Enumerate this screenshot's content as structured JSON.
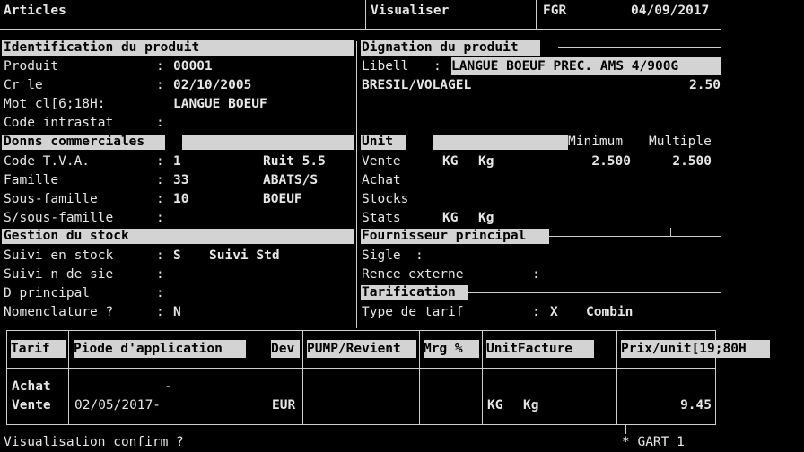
{
  "topbar": {
    "screen": "Articles",
    "mode": "Visualiser",
    "company": "FGR",
    "date": "04/09/2017"
  },
  "ident": {
    "title": "Identification du produit",
    "fields": [
      {
        "label": "Produit",
        "sep": ":",
        "value": "00001"
      },
      {
        "label": "Cr le",
        "sep": ":",
        "value": "02/10/2005"
      },
      {
        "label": "Mot cl[6;18H:",
        "value": "LANGUE BOEUF"
      },
      {
        "label": "Code intrastat",
        "sep": ":"
      }
    ]
  },
  "design": {
    "title": "Dignation du produit",
    "label": "Libell",
    "sep": ":",
    "value": "LANGUE BOEUF PREC. AMS 4/900G",
    "origin": "BRESIL/VOLAGEL",
    "number": "2.50"
  },
  "comm": {
    "title": "Donns commerciales",
    "fields": [
      {
        "label": "Code T.V.A.",
        "sep": ":",
        "value": "1",
        "extra": "Ruit 5.5"
      },
      {
        "label": "Famille",
        "sep": ":",
        "value": "33",
        "extra": "ABATS/S"
      },
      {
        "label": "Sous-famille",
        "sep": ":",
        "value": "10",
        "extra": "BOEUF"
      },
      {
        "label": "S/sous-famille",
        "sep": ":"
      }
    ]
  },
  "unit": {
    "title": "Unit",
    "col_min": "Minimum",
    "col_mult": "Multiple",
    "rows": [
      {
        "label": "Vente",
        "u1": "KG",
        "u2": "Kg",
        "min": "2.500",
        "mult": "2.500"
      },
      {
        "label": "Achat"
      },
      {
        "label": "Stocks"
      },
      {
        "label": "Stats",
        "u1": "KG",
        "u2": "Kg"
      }
    ]
  },
  "stock": {
    "title": "Gestion du stock",
    "fields": [
      {
        "label": "Suivi en stock",
        "sep": ":",
        "value": "S",
        "extra": "Suivi Std"
      },
      {
        "label": "Suivi n de sie",
        "sep": ":"
      },
      {
        "label": "D principal",
        "sep": ":"
      },
      {
        "label": "Nomenclature ?",
        "sep": ":",
        "value": "N"
      }
    ]
  },
  "fournisseur": {
    "title": "Fournisseur principal",
    "sigle_label": "Sigle",
    "sigle_sep": ":",
    "ref_label": "Rence externe",
    "ref_sep": ":"
  },
  "tarification": {
    "title": "Tarification",
    "type_label": "Type de tarif",
    "type_sep": ":",
    "type_value": "X",
    "type_extra": "Combin"
  },
  "price_table": {
    "headers": [
      "Tarif",
      "Piode d'application",
      "Dev",
      "PUMP/Revient",
      "Mrg %",
      "UnitFacture",
      "Prix/unit[19;80H"
    ],
    "rows": [
      {
        "tarif": "Achat",
        "periode": "-",
        "dev": "",
        "pump": "",
        "mrg": "",
        "u1": "",
        "u2": "",
        "prix": ""
      },
      {
        "tarif": "Vente",
        "periode": "02/05/2017-",
        "dev": "EUR",
        "pump": "",
        "mrg": "",
        "u1": "KG",
        "u2": "Kg",
        "prix": "9.45"
      }
    ]
  },
  "footer": {
    "prompt": "Visualisation confirm ?",
    "program": "* GART 1"
  }
}
